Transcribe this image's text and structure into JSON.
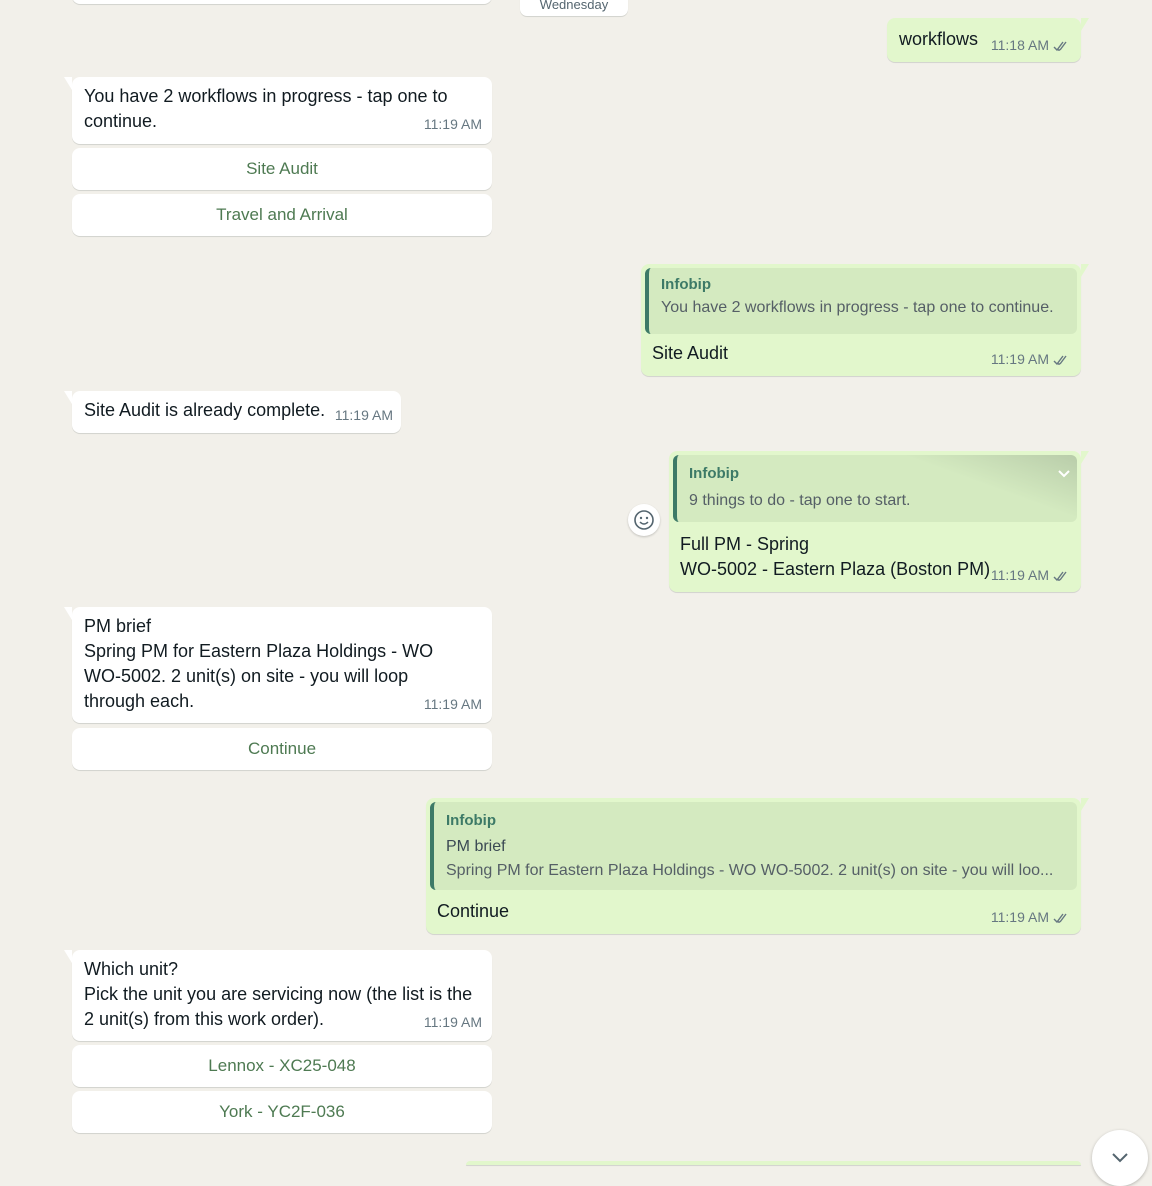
{
  "date_chip": "Wednesday",
  "messages": {
    "m1": {
      "text": "workflows",
      "time": "11:18 AM"
    },
    "m2": {
      "text": "You have 2 workflows in progress - tap one to continue.",
      "time": "11:19 AM",
      "buttons": [
        "Site Audit",
        "Travel and Arrival"
      ]
    },
    "m3": {
      "quote_sender": "Infobip",
      "quote_text": "You have 2 workflows in progress - tap one to continue.",
      "text": "Site Audit",
      "time": "11:19 AM"
    },
    "m4": {
      "text": "Site Audit is already complete.",
      "time": "11:19 AM"
    },
    "m5": {
      "quote_sender": "Infobip",
      "quote_text": "9 things to do - tap one to start.",
      "line1": "Full PM - Spring",
      "line2": "WO-5002 - Eastern Plaza (Boston PM)",
      "time": "11:19 AM"
    },
    "m6": {
      "line1": "PM brief",
      "line2": "Spring PM for Eastern Plaza Holdings - WO WO-5002. 2 unit(s) on site - you will loop through each.",
      "time": "11:19 AM",
      "buttons": [
        "Continue"
      ]
    },
    "m7": {
      "quote_sender": "Infobip",
      "quote_line1": "PM brief",
      "quote_line2": "Spring PM for Eastern Plaza Holdings - WO WO-5002. 2 unit(s) on site - you will loo...",
      "text": "Continue",
      "time": "11:19 AM"
    },
    "m8": {
      "line1": "Which unit?",
      "line2": "Pick the unit you are servicing now (the list is the 2 unit(s) from this work order).",
      "time": "11:19 AM",
      "buttons": [
        "Lennox - XC25-048",
        "York - YC2F-036"
      ]
    }
  },
  "icons": {
    "read_receipt": "double-check-icon",
    "emoji": "emoji-icon",
    "scroll": "chevron-down-icon",
    "menu": "chevron-down-icon"
  },
  "colors": {
    "incoming": "#ffffff",
    "outgoing": "#e2f7cc",
    "button_text": "#4e7a52",
    "quote_bar": "#3d7a67"
  }
}
